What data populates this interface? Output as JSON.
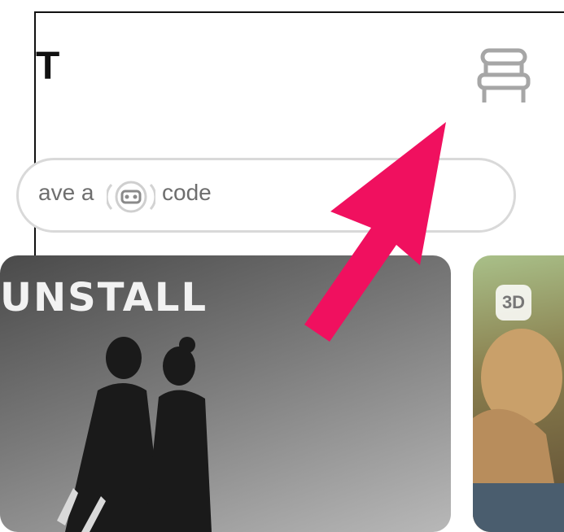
{
  "header": {
    "title": "T",
    "icon": "seat-icon"
  },
  "code_field": {
    "prefix": "ave a",
    "icon": "vr-headset-icon",
    "suffix": "code"
  },
  "cards": [
    {
      "title": "UNSTALL",
      "image": "couple-photo"
    },
    {
      "badge": "3D",
      "image": "outdoor-photo"
    }
  ],
  "colors": {
    "title_text": "#111111",
    "placeholder_text": "#6e6e6e",
    "field_border": "#d9d9d9",
    "arrow": "#f0105f"
  }
}
